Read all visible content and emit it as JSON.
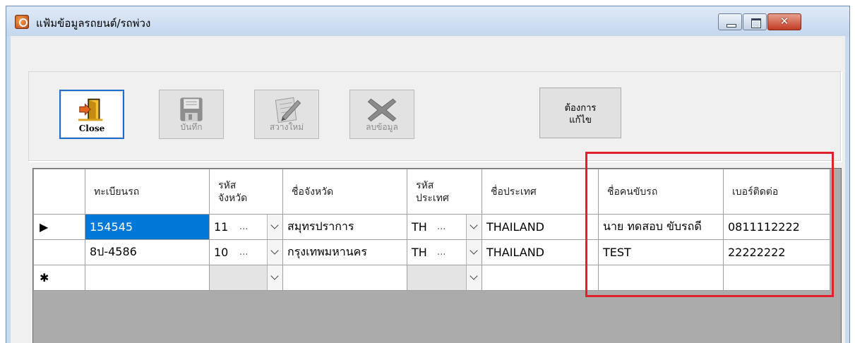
{
  "window": {
    "title": "แฟ้มข้อมูลรถยนต์/รถพ่วง"
  },
  "toolbar": {
    "close_label": "Close",
    "save_label": "บันทึก",
    "clear_label": "สวางใหม่",
    "delete_label": "ลบข้อมูล",
    "edit_line1": "ต้องการ",
    "edit_line2": "แก้ไข"
  },
  "grid": {
    "columns": [
      "ทะเบียนรถ",
      "รหัส จังหวัด",
      "ชื่อจังหวัด",
      "รหัส ประเทศ",
      "ชื่อประเทศ",
      "ชื่อคนขับรถ",
      "เบอร์ติดต่อ"
    ],
    "header_province_code_line1": "รหัส",
    "header_province_code_line2": "จังหวัด",
    "header_country_code_line1": "รหัส",
    "header_country_code_line2": "ประเทศ",
    "rows": [
      {
        "indicator": "▶",
        "plate": "154545",
        "province_code": "11",
        "province_name": "สมุทรปราการ",
        "country_code": "TH",
        "country_name": "THAILAND",
        "driver": "นาย ทดสอบ ขับรถดี",
        "phone": "0811112222"
      },
      {
        "indicator": "",
        "plate": "8ป-4586",
        "province_code": "10",
        "province_name": "กรุงเทพมหานคร",
        "country_code": "TH",
        "country_name": "THAILAND",
        "driver": "TEST",
        "phone": "22222222"
      }
    ],
    "new_row_indicator": "✱",
    "dots": "..."
  },
  "colors": {
    "selection": "#0078d7",
    "highlight_box": "#e0202a",
    "titlebar": "#c9dbee"
  }
}
